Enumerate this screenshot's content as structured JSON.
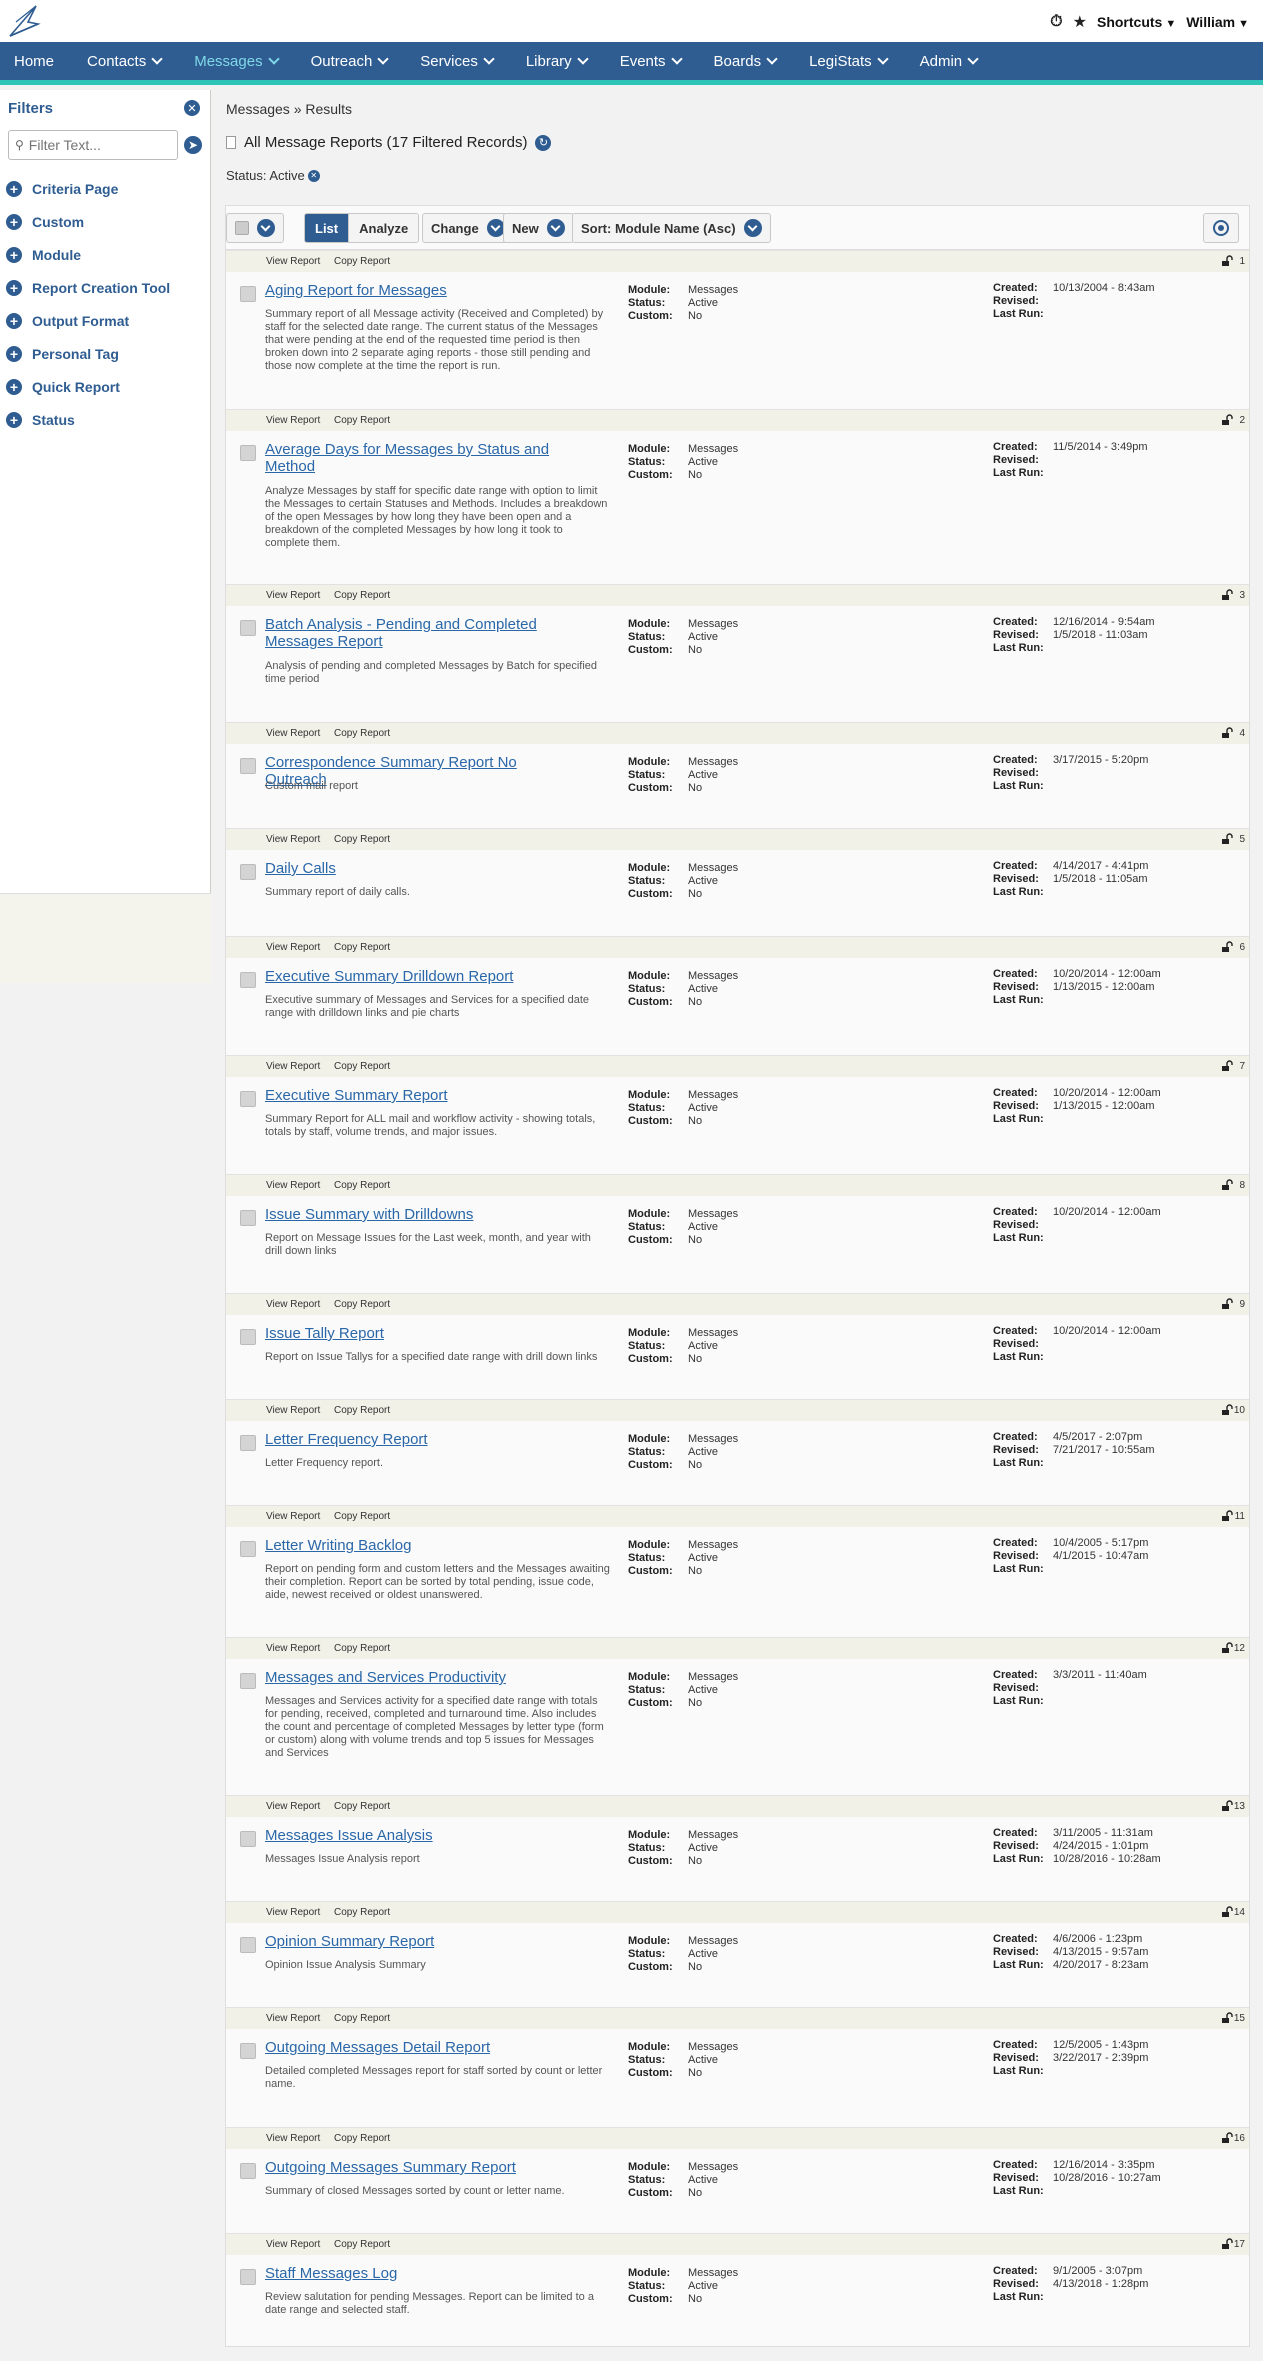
{
  "topbar": {
    "shortcuts_label": "Shortcuts",
    "user_label": "William"
  },
  "nav": {
    "items": [
      {
        "label": "Home",
        "caret": false
      },
      {
        "label": "Contacts",
        "caret": true
      },
      {
        "label": "Messages",
        "caret": true,
        "active": true
      },
      {
        "label": "Outreach",
        "caret": true
      },
      {
        "label": "Services",
        "caret": true
      },
      {
        "label": "Library",
        "caret": true
      },
      {
        "label": "Events",
        "caret": true
      },
      {
        "label": "Boards",
        "caret": true
      },
      {
        "label": "LegiStats",
        "caret": true
      },
      {
        "label": "Admin",
        "caret": true
      }
    ]
  },
  "sidebar": {
    "title": "Filters",
    "search_placeholder": "Filter Text...",
    "items": [
      "Criteria Page",
      "Custom",
      "Module",
      "Report Creation Tool",
      "Output Format",
      "Personal Tag",
      "Quick Report",
      "Status"
    ]
  },
  "header": {
    "breadcrumb": "Messages » Results",
    "title": "All Message Reports (17 Filtered Records)",
    "status_filter": "Status: Active"
  },
  "toolbar": {
    "list_label": "List",
    "analyze_label": "Analyze",
    "change_label": "Change",
    "new_label": "New",
    "sort_label": "Sort: Module Name (Asc)"
  },
  "labels": {
    "view_report": "View Report",
    "copy_report": "Copy Report",
    "module": "Module:",
    "status": "Status:",
    "custom": "Custom:",
    "created": "Created:",
    "revised": "Revised:",
    "last_run": "Last Run:"
  },
  "reports": [
    {
      "num": "1",
      "title": "Aging Report for Messages",
      "desc": "Summary report of all Message activity (Received and Completed) by staff for the selected date range.  The current status of the Messages that were pending at the end of the requested time period is then broken down into 2 separate aging reports - those still pending and those now complete at the time the report is run.",
      "module": "Messages",
      "status": "Active",
      "custom": "No",
      "created": "10/13/2004 - 8:43am",
      "revised": "",
      "last_run": ""
    },
    {
      "num": "2",
      "title": "Average Days for Messages by Status and Method",
      "desc": "Analyze Messages by staff for specific date range with option to limit the Messages to certain Statuses and Methods.  Includes a breakdown of the open Messages by how long they have been open and a breakdown of the completed Messages by how long it took to complete them.",
      "module": "Messages",
      "status": "Active",
      "custom": "No",
      "created": "11/5/2014 - 3:49pm",
      "revised": "",
      "last_run": ""
    },
    {
      "num": "3",
      "title": "Batch Analysis - Pending and Completed Messages Report",
      "desc": "Analysis of pending and completed Messages by Batch for specified time period",
      "module": "Messages",
      "status": "Active",
      "custom": "No",
      "created": "12/16/2014 - 9:54am",
      "revised": "1/5/2018 - 11:03am",
      "last_run": ""
    },
    {
      "num": "4",
      "title": "Correspondence Summary Report No Outreach",
      "desc": "Custom mail report",
      "module": "Messages",
      "status": "Active",
      "custom": "No",
      "created": "3/17/2015 - 5:20pm",
      "revised": "",
      "last_run": ""
    },
    {
      "num": "5",
      "title": "Daily Calls",
      "desc": "Summary report of daily calls.",
      "module": "Messages",
      "status": "Active",
      "custom": "No",
      "created": "4/14/2017 - 4:41pm",
      "revised": "1/5/2018 - 11:05am",
      "last_run": ""
    },
    {
      "num": "6",
      "title": "Executive Summary Drilldown Report",
      "desc": "Executive summary of Messages and Services for a specified date range with drilldown links and pie charts",
      "module": "Messages",
      "status": "Active",
      "custom": "No",
      "created": "10/20/2014 - 12:00am",
      "revised": "1/13/2015 - 12:00am",
      "last_run": ""
    },
    {
      "num": "7",
      "title": "Executive Summary Report",
      "desc": "Summary Report for ALL mail and workflow activity - showing totals, totals by staff, volume trends, and major issues.",
      "module": "Messages",
      "status": "Active",
      "custom": "No",
      "created": "10/20/2014 - 12:00am",
      "revised": "1/13/2015 - 12:00am",
      "last_run": ""
    },
    {
      "num": "8",
      "title": "Issue Summary with Drilldowns",
      "desc": "Report on Message Issues for the Last week, month, and year with drill down links",
      "module": "Messages",
      "status": "Active",
      "custom": "No",
      "created": "10/20/2014 - 12:00am",
      "revised": "",
      "last_run": ""
    },
    {
      "num": "9",
      "title": "Issue Tally Report",
      "desc": "Report on Issue Tallys for a specified date range with drill down links",
      "module": "Messages",
      "status": "Active",
      "custom": "No",
      "created": "10/20/2014 - 12:00am",
      "revised": "",
      "last_run": ""
    },
    {
      "num": "10",
      "title": "Letter Frequency Report",
      "desc": "Letter Frequency report.",
      "module": "Messages",
      "status": "Active",
      "custom": "No",
      "created": "4/5/2017 - 2:07pm",
      "revised": "7/21/2017 - 10:55am",
      "last_run": ""
    },
    {
      "num": "11",
      "title": "Letter Writing Backlog",
      "desc": "Report on pending form and custom letters and the Messages awaiting their completion. Report can be sorted by total pending, issue code, aide, newest received or oldest unanswered.",
      "module": "Messages",
      "status": "Active",
      "custom": "No",
      "created": "10/4/2005 - 5:17pm",
      "revised": "4/1/2015 - 10:47am",
      "last_run": ""
    },
    {
      "num": "12",
      "title": "Messages and Services Productivity",
      "desc": "Messages and Services activity for a specified date range with totals for pending, received, completed and turnaround time. Also includes the count and percentage of completed Messages by letter type (form or custom) along with volume trends and top 5 issues for Messages and Services",
      "module": "Messages",
      "status": "Active",
      "custom": "No",
      "created": "3/3/2011 - 11:40am",
      "revised": "",
      "last_run": ""
    },
    {
      "num": "13",
      "title": "Messages Issue Analysis",
      "desc": "Messages Issue Analysis report",
      "module": "Messages",
      "status": "Active",
      "custom": "No",
      "created": "3/11/2005 - 11:31am",
      "revised": "4/24/2015 - 1:01pm",
      "last_run": "10/28/2016 - 10:28am"
    },
    {
      "num": "14",
      "title": "Opinion Summary Report",
      "desc": "Opinion Issue Analysis Summary",
      "module": "Messages",
      "status": "Active",
      "custom": "No",
      "created": "4/6/2006 - 1:23pm",
      "revised": "4/13/2015 - 9:57am",
      "last_run": "4/20/2017 - 8:23am"
    },
    {
      "num": "15",
      "title": "Outgoing Messages Detail Report",
      "desc": "Detailed completed Messages report for staff sorted by count or letter name.",
      "module": "Messages",
      "status": "Active",
      "custom": "No",
      "created": "12/5/2005 - 1:43pm",
      "revised": "3/22/2017 - 2:39pm",
      "last_run": ""
    },
    {
      "num": "16",
      "title": "Outgoing Messages Summary Report",
      "desc": "Summary of closed Messages sorted by count or letter name.",
      "module": "Messages",
      "status": "Active",
      "custom": "No",
      "created": "12/16/2014 - 3:35pm",
      "revised": "10/28/2016 - 10:27am",
      "last_run": ""
    },
    {
      "num": "17",
      "title": "Staff Messages Log",
      "desc": "Review salutation for pending Messages.  Report can be limited to a date range and selected staff.",
      "module": "Messages",
      "status": "Active",
      "custom": "No",
      "created": "9/1/2005 - 3:07pm",
      "revised": "4/13/2018 - 1:28pm",
      "last_run": ""
    }
  ]
}
